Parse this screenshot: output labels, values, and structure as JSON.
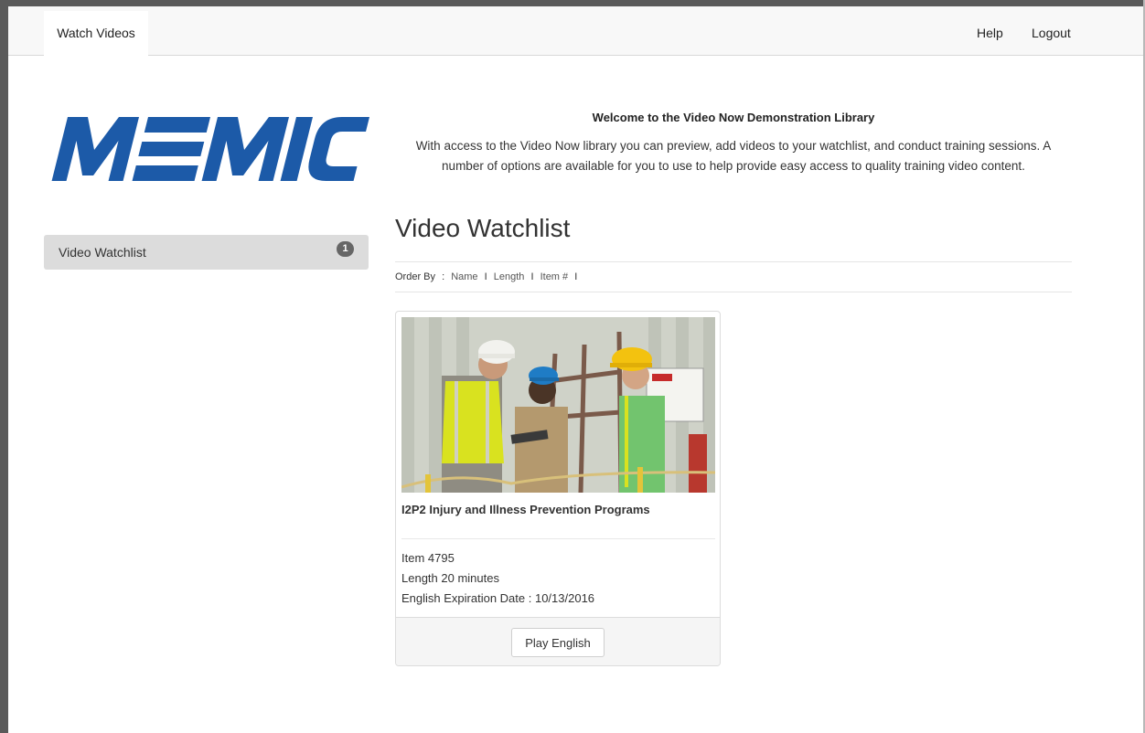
{
  "navbar": {
    "active_tab": "Watch Videos",
    "help": "Help",
    "logout": "Logout"
  },
  "logo": {
    "text": "MEMIC",
    "color": "#1c5aa8"
  },
  "sidebar": {
    "items": [
      {
        "label": "Video Watchlist",
        "badge": "1"
      }
    ]
  },
  "welcome": {
    "title": "Welcome to the Video Now Demonstration Library",
    "text": "With access to the Video Now library you can preview, add videos to your watchlist, and conduct training sessions. A number of options are available for you to use to help provide easy access to quality training video content."
  },
  "main": {
    "title": "Video Watchlist",
    "order_by": {
      "label": "Order By",
      "colon": ":",
      "separator": "I",
      "options": [
        "Name",
        "Length",
        "Item #"
      ]
    }
  },
  "video_card": {
    "title": "I2P2 Injury and Illness Prevention Programs",
    "item": "Item 4795",
    "length": "Length 20 minutes",
    "expiration": "English Expiration Date : 10/13/2016",
    "play_label": "Play English"
  },
  "colors": {
    "navbar_bg": "#f8f8f8",
    "sidebar_active_bg": "#dcdcdc",
    "badge_bg": "#666666",
    "card_footer_bg": "#f5f5f5"
  }
}
